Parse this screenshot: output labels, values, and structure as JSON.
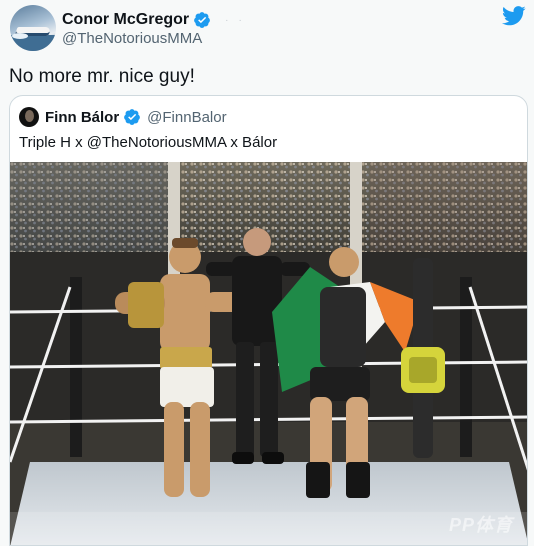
{
  "tweet": {
    "display_name": "Conor McGregor",
    "handle": "@TheNotoriousMMA",
    "text": "No more mr. nice guy!",
    "avatar_icon": "speedboat-avatar",
    "brand_icon": "twitter-bird-icon",
    "brand_color": "#1d9bf0"
  },
  "quoted_tweet": {
    "display_name": "Finn Bálor",
    "handle": "@FinnBalor",
    "text": "Triple H x @TheNotoriousMMA x Bálor",
    "media_alt_icon": "wrestling-action-figures-photo"
  },
  "watermark": {
    "text": "PP体育"
  },
  "colors": {
    "verified": "#1d9bf0",
    "secondary_text": "#536471",
    "border": "#cfd9de"
  }
}
